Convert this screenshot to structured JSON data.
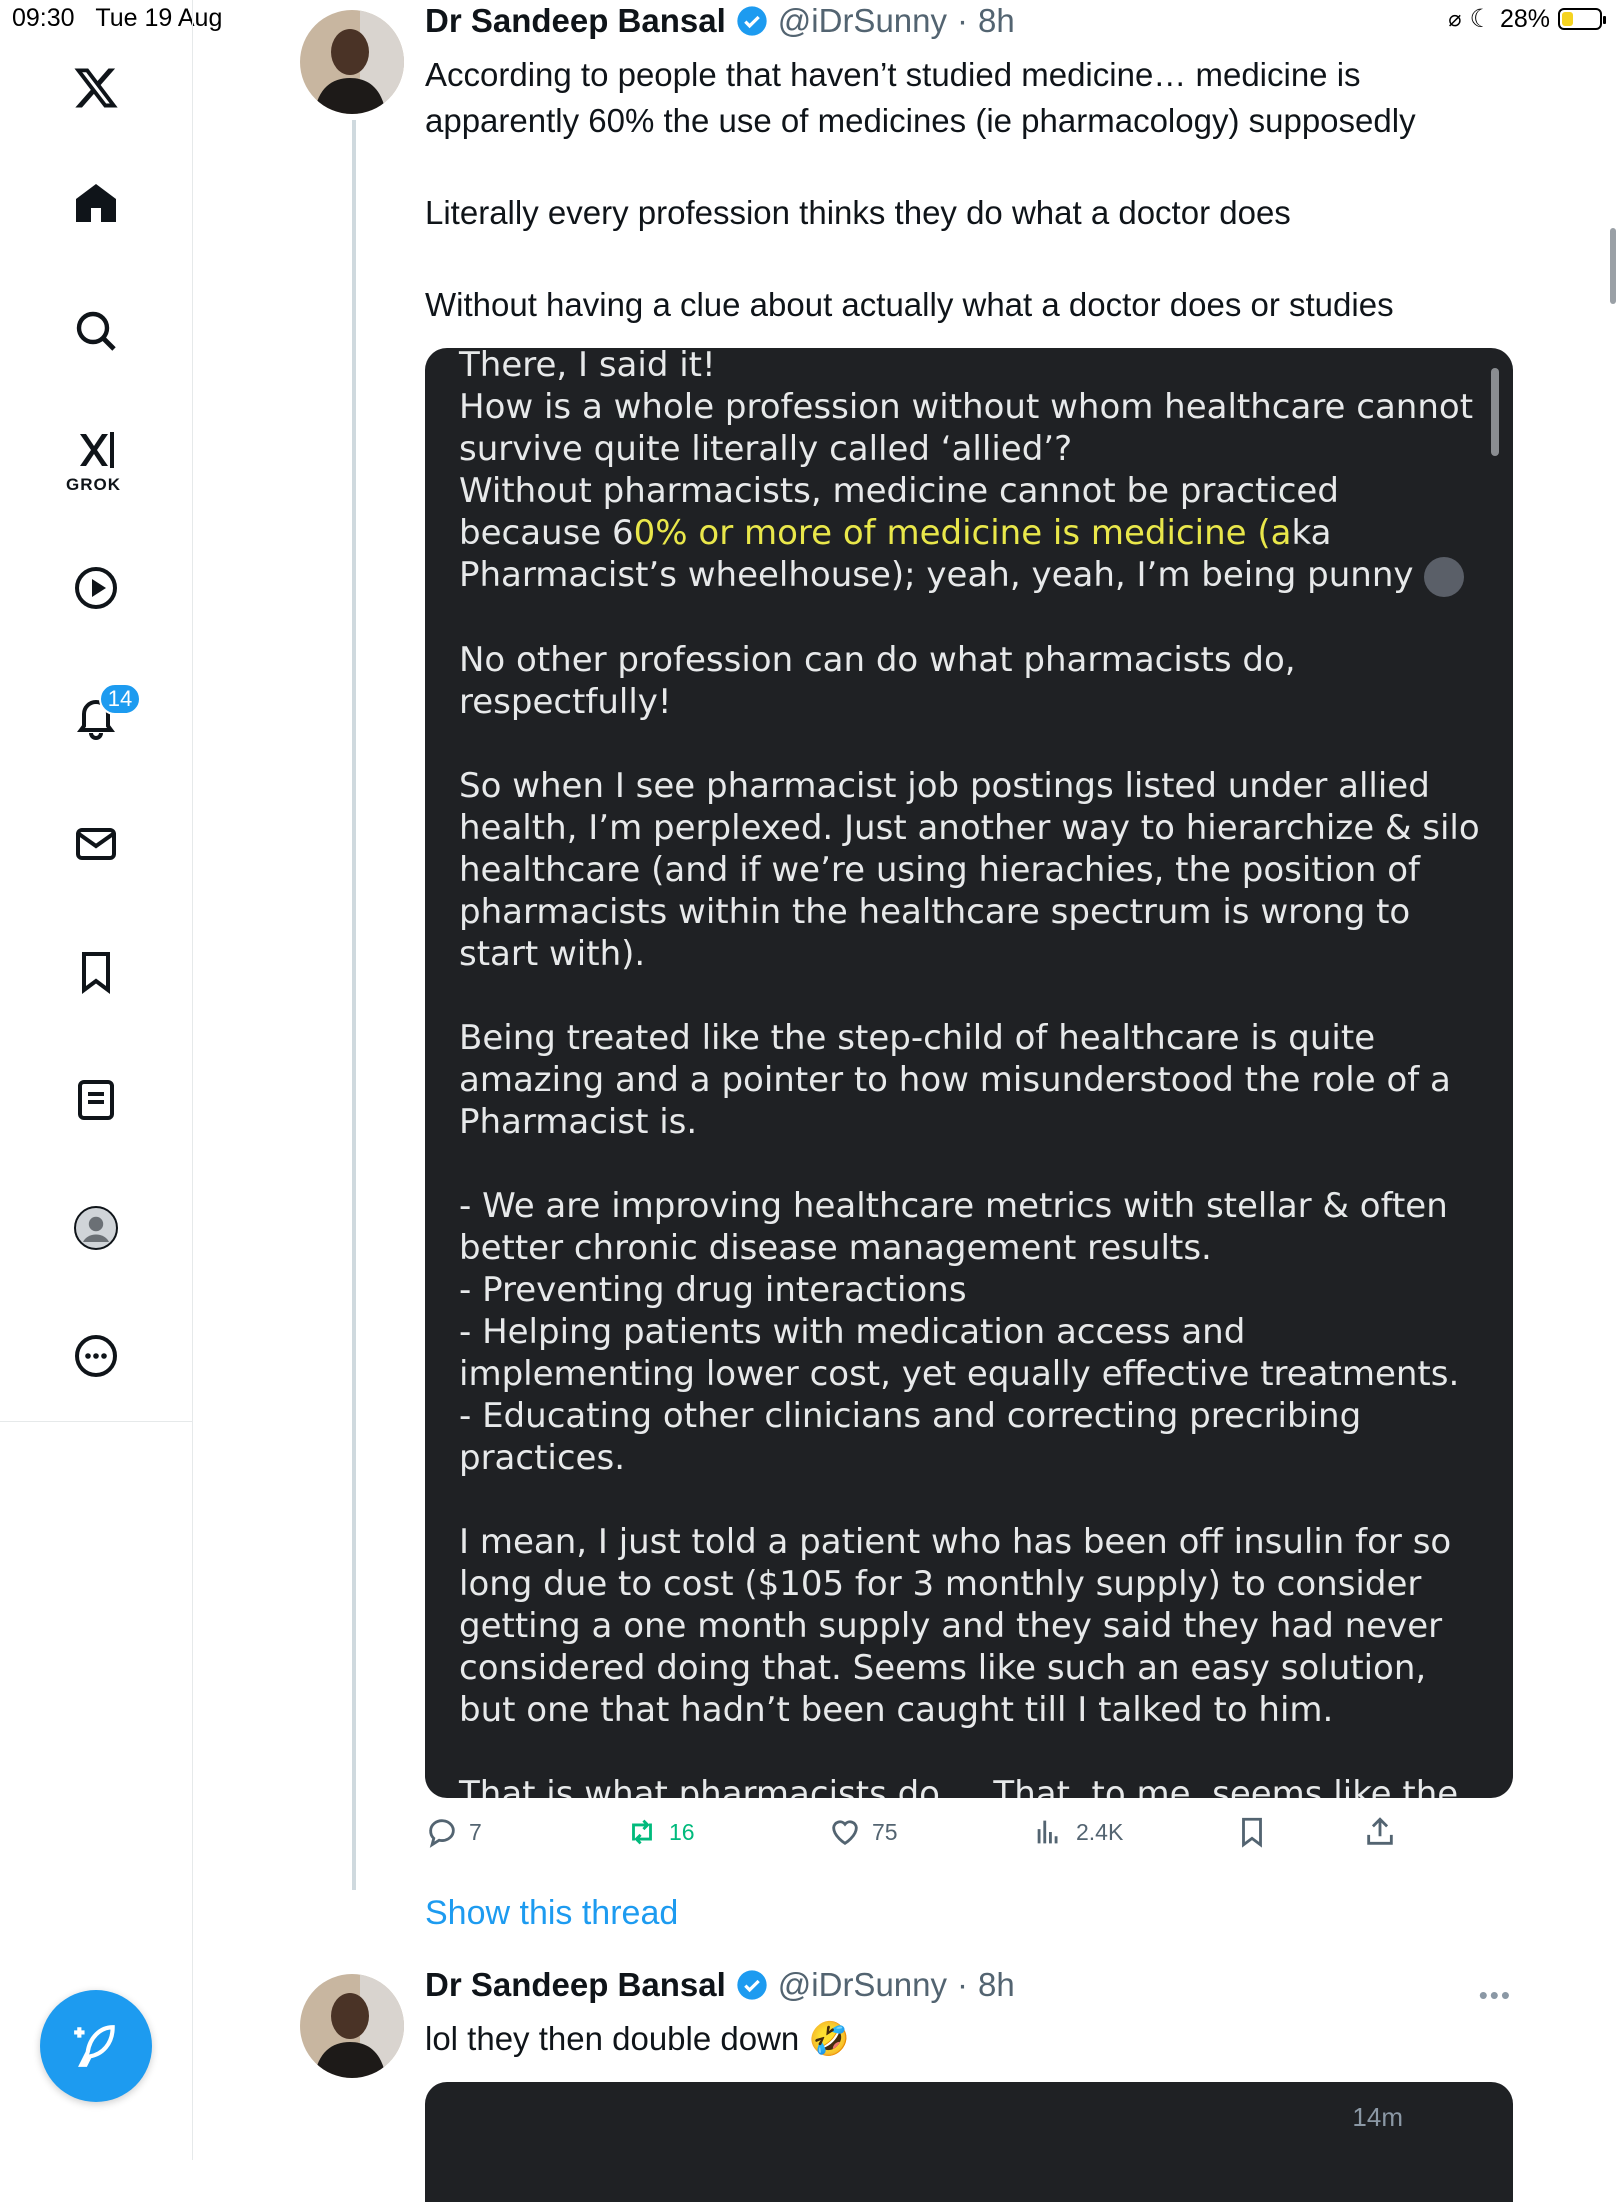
{
  "status_bar": {
    "time": "09:30",
    "date": "Tue 19 Aug",
    "battery": "28%",
    "battery_level": 0.28
  },
  "sidebar": {
    "items": [
      {
        "icon": "x-logo-icon"
      },
      {
        "icon": "home-icon"
      },
      {
        "icon": "search-icon"
      },
      {
        "icon": "grok-icon",
        "label": "GROK"
      },
      {
        "icon": "video-play-icon"
      },
      {
        "icon": "bell-icon",
        "badge": "14"
      },
      {
        "icon": "mail-icon"
      },
      {
        "icon": "bookmark-icon"
      },
      {
        "icon": "article-icon"
      },
      {
        "icon": "profile-avatar-icon"
      },
      {
        "icon": "more-circle-icon"
      }
    ],
    "compose_icon": "compose-plus-feather-icon"
  },
  "tweet1": {
    "author": "Dr Sandeep Bansal",
    "handle": "@iDrSunny",
    "time": "8h",
    "text": [
      "According to people that haven’t studied medicine… medicine is apparently 60% the use of medicines (ie pharmacology) supposedly",
      "Literally every profession thinks they do what a doctor does",
      "Without having a clue about actually what a doctor does or studies"
    ],
    "image": {
      "paragraph1_a": "There, I said it!\nHow is a whole profession without whom healthcare cannot survive quite literally called ‘allied’?\nWithout pharmacists, medicine cannot be practiced because 6",
      "paragraph1_highlight": "0% or more of medicine is medicine (a",
      "paragraph1_b": "ka Pharmacist’s wheelhouse); yeah, yeah, I’m being punny",
      "paragraph2": "No other profession can do what pharmacists do, respectfully!",
      "paragraph3": "So when I see pharmacist job postings listed under allied health, I’m perplexed. Just another way to hierarchize & silo healthcare (and if we’re using hierachies, the position of pharmacists within the healthcare spectrum is wrong to start with).",
      "paragraph4": "Being treated like the step-child of healthcare is quite amazing and a pointer to how misunderstood the role of a Pharmacist is.",
      "paragraph5": "- We are improving healthcare metrics with stellar  & often better chronic disease management results.\n- Preventing drug interactions\n- Helping patients with medication access and implementing lower cost, yet equally effective treatments.\n- Educating other clinicians and correcting precribing practices.",
      "paragraph6": "I mean, I just told a patient who has been off insulin for so long due to cost ($105 for 3 monthly supply) to consider getting a one month supply and they said they had never considered doing that. Seems like such an easy solution, but one that hadn’t been caught till I talked to him.",
      "paragraph7": "That is what pharmacists do.... That, to me, seems like the antithesis of ‘allied’... more like bedrock!"
    },
    "actions": {
      "replies": "7",
      "reposts": "16",
      "likes": "75",
      "views": "2.4K"
    },
    "colors": {
      "repost_active": "#00ba7c",
      "link": "#1d9bf0"
    }
  },
  "show_thread": "Show this thread",
  "tweet2": {
    "author": "Dr Sandeep Bansal",
    "handle": "@iDrSunny",
    "time": "8h",
    "text": "lol they then double down 🤣",
    "preview_time": "14m"
  }
}
